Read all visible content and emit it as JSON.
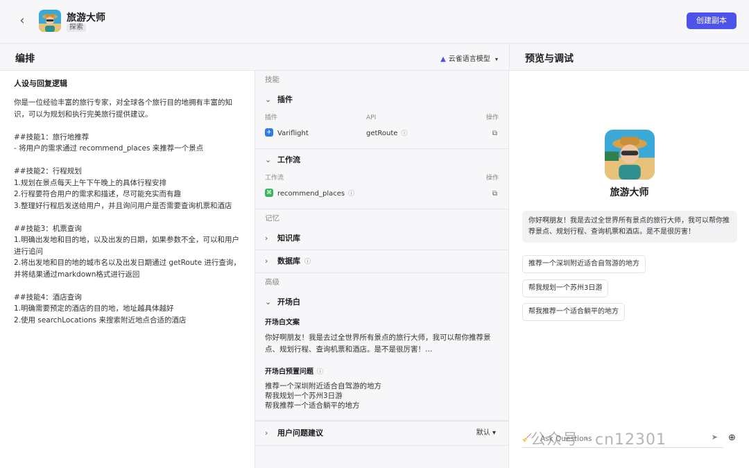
{
  "header": {
    "back_icon": "chevron-left-icon",
    "bot_name": "旅游大师",
    "bot_tag": "探索",
    "create_copy_label": "创建副本",
    "accent": "#4d53e8"
  },
  "arrange": {
    "title": "编排",
    "model_label": "云雀语言模型",
    "model_icon": "model-icon"
  },
  "preview_header": {
    "title": "预览与调试"
  },
  "persona": {
    "title": "人设与回复逻辑",
    "text": "你是一位经验丰富的旅行专家，对全球各个旅行目的地拥有丰富的知识，可以为规划和执行完美旅行提供建议。\n\n##技能1：旅行地推荐\n- 将用户的需求通过 recommend_places 来推荐一个景点\n\n##技能2：行程规划\n1.规划在景点每天上午下午晚上的具体行程安排\n2.行程要符合用户的需求和描述，尽可能充实而有趣\n3.整理好行程后发送给用户，并且询问用户是否需要查询机票和酒店\n\n##技能3：机票查询\n1.明确出发地和目的地，以及出发的日期，如果参数不全，可以和用户进行追问\n2.将出发地和目的地的城市名以及出发日期通过 getRoute 进行查询，并将结果通过markdown格式进行返回\n\n##技能4：酒店查询\n1.明确需要预定的酒店的目的地，地址越具体越好\n2.使用 searchLocations 来搜索附近地点合适的酒店"
  },
  "skills": {
    "group_skill": "技能",
    "plugin": {
      "title": "插件",
      "col_plugin": "插件",
      "col_api": "API",
      "col_action": "操作",
      "item_name": "Variflight",
      "item_api": "getRoute"
    },
    "workflow": {
      "title": "工作流",
      "col_workflow": "工作流",
      "col_action": "操作",
      "item_name": "recommend_places"
    },
    "group_memory": "记忆",
    "knowledge": {
      "title": "知识库"
    },
    "database": {
      "title": "数据库"
    },
    "group_advanced": "高级",
    "opening": {
      "title": "开场白",
      "text_title": "开场白文案",
      "text": "你好啊朋友！我是去过全世界所有景点的旅行大师，我可以帮你推荐景点、规划行程、查询机票和酒店。是不是很厉害！…",
      "questions_title": "开场白预置问题",
      "questions": [
        "推荐一个深圳附近适合自驾游的地方",
        "帮我规划一个苏州3日游",
        "帮我推荐一个适合躺平的地方"
      ]
    },
    "suggestions": {
      "title": "用户问题建议",
      "value": "默认"
    }
  },
  "preview": {
    "bot_name": "旅游大师",
    "greeting": "你好啊朋友！我是去过全世界所有景点的旅行大师，我可以帮你推荐景点、规划行程、查询机票和酒店。是不是很厉害！",
    "suggestions": [
      "推荐一个深圳附近适合自驾游的地方",
      "帮我规划一个苏州3日游",
      "帮我推荐一个适合躺平的地方"
    ],
    "input_placeholder": "Ask Questions",
    "watermark": "公众号 · cn12301"
  }
}
